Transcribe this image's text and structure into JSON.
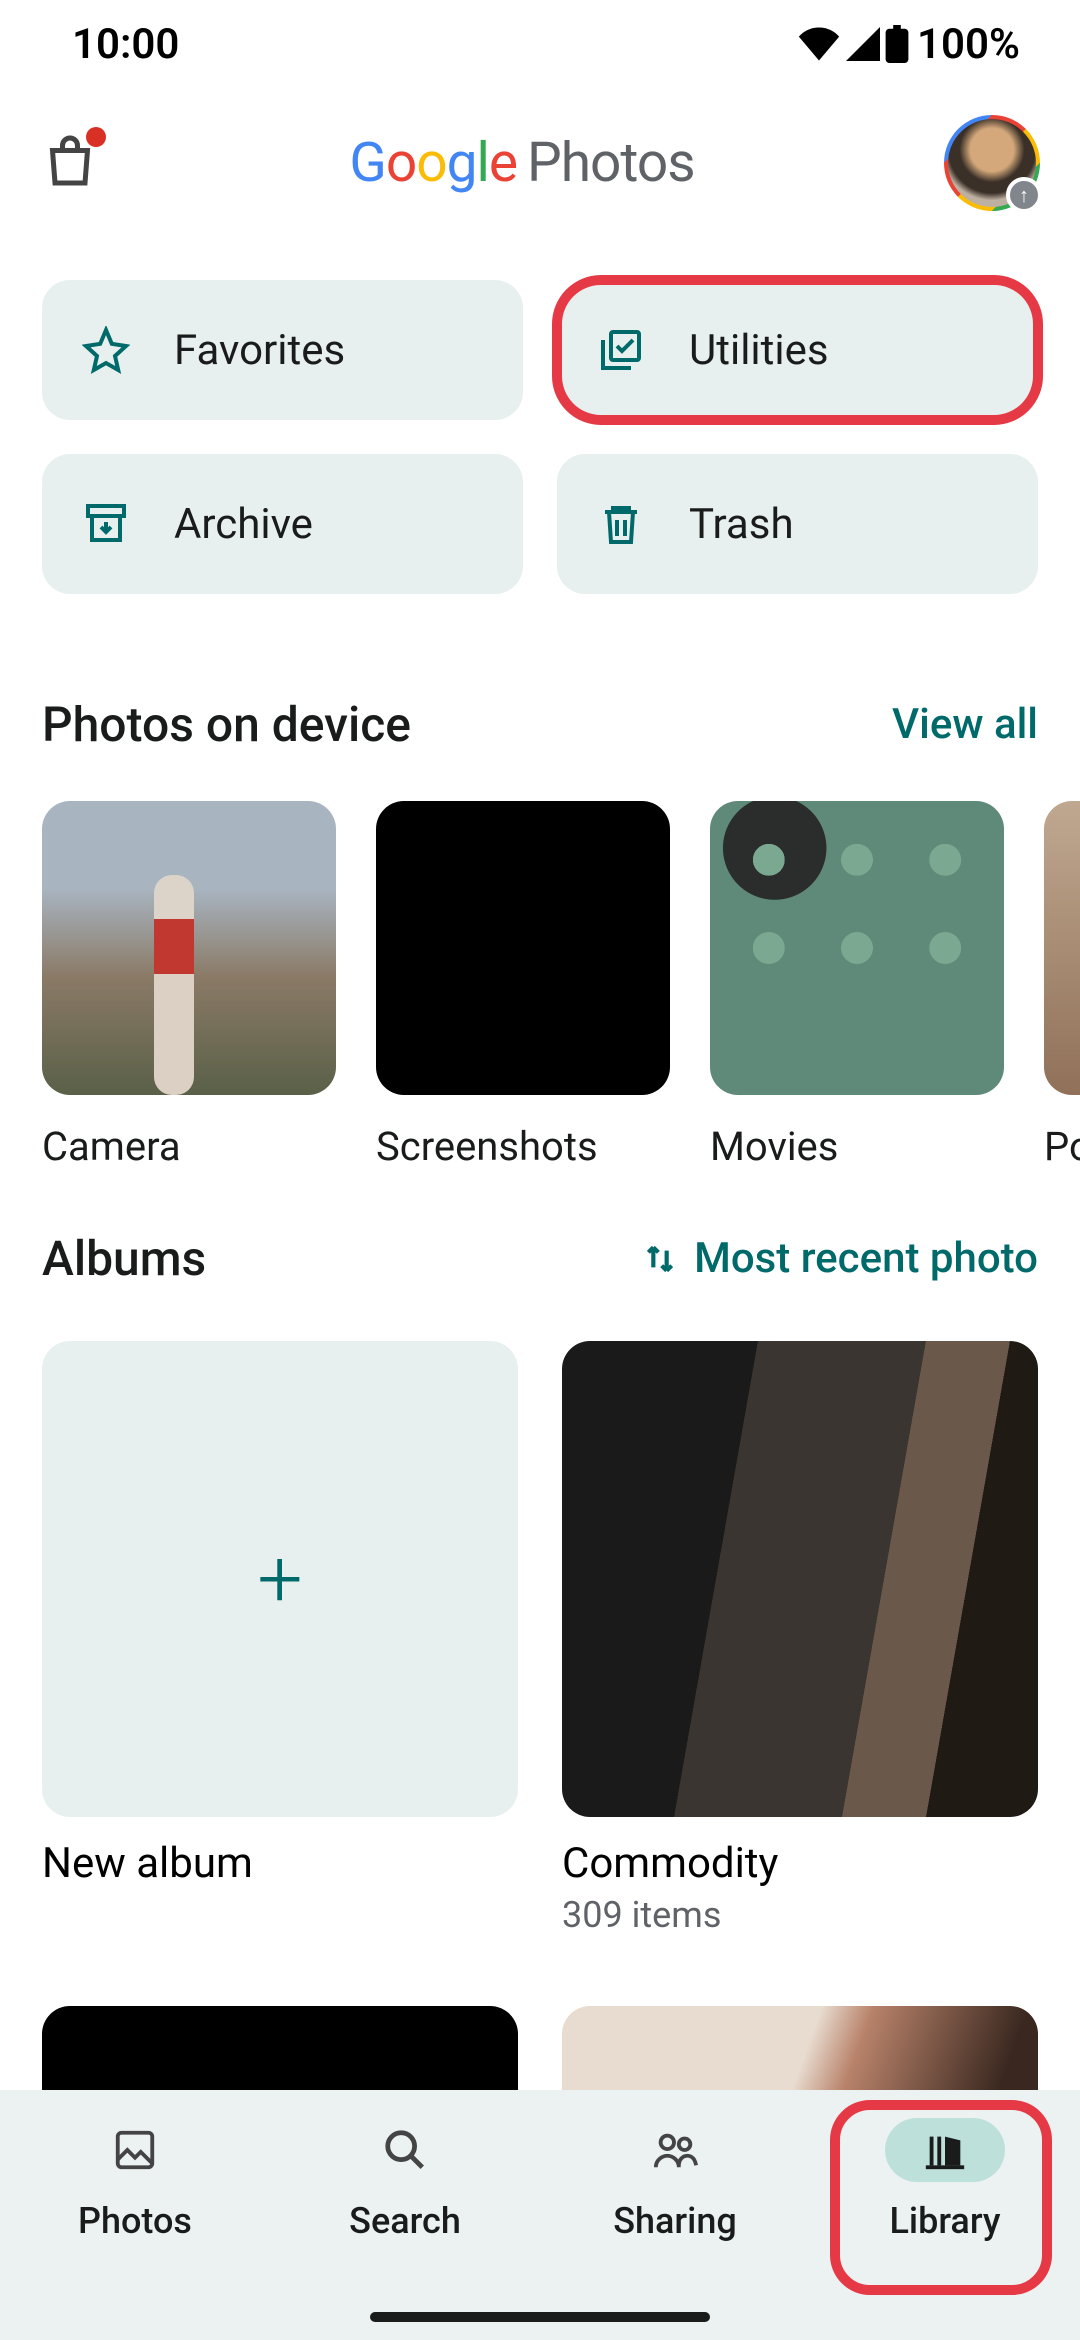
{
  "status": {
    "time": "10:00",
    "battery": "100%"
  },
  "header": {
    "app_name": "Google Photos"
  },
  "chips": {
    "favorites": "Favorites",
    "utilities": "Utilities",
    "archive": "Archive",
    "trash": "Trash"
  },
  "device_section": {
    "title": "Photos on device",
    "view_all": "View all",
    "folders": [
      {
        "label": "Camera"
      },
      {
        "label": "Screenshots"
      },
      {
        "label": "Movies"
      },
      {
        "label": "Po"
      }
    ]
  },
  "albums_section": {
    "title": "Albums",
    "sort": "Most recent photo",
    "new_album": "New album",
    "items": [
      {
        "title": "Commodity",
        "subtitle": "309 items"
      }
    ]
  },
  "nav": {
    "photos": "Photos",
    "search": "Search",
    "sharing": "Sharing",
    "library": "Library"
  }
}
